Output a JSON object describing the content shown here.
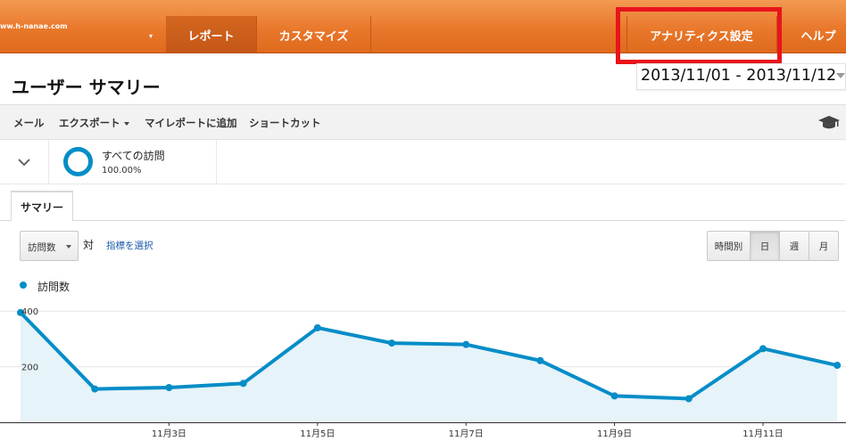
{
  "header": {
    "site": "ww.h-nanae.com",
    "nav": {
      "report": "レポート",
      "customize": "カスタマイズ",
      "analytics_settings": "アナリティクス設定",
      "help": "ヘルプ"
    }
  },
  "page": {
    "title": "ユーザー サマリー",
    "date_range": "2013/11/01 - 2013/11/12"
  },
  "toolbar": {
    "mail": "メール",
    "export": "エクスポート",
    "add_to_my_report": "マイレポートに追加",
    "shortcut": "ショートカット",
    "icon": "graduation-cap-icon"
  },
  "segment": {
    "name": "すべての訪問",
    "percent": "100.00%"
  },
  "tabs": {
    "summary": "サマリー"
  },
  "controls": {
    "metric": "訪問数",
    "versus": "対",
    "select_metric": "指標を選択",
    "granularity": {
      "hourly": "時間別",
      "day": "日",
      "week": "週",
      "month": "月",
      "selected": "日"
    }
  },
  "colors": {
    "nav_orange": "#e9782b",
    "series": "#058dc7",
    "highlight": "#e8141b"
  },
  "chart_data": {
    "type": "area",
    "series": [
      {
        "name": "訪問数",
        "x": [
          "11月1日",
          "11月2日",
          "11月3日",
          "11月4日",
          "11月5日",
          "11月6日",
          "11月7日",
          "11月8日",
          "11月9日",
          "11月10日",
          "11月11日",
          "11月12日"
        ],
        "values": [
          395,
          120,
          125,
          140,
          340,
          285,
          280,
          222,
          95,
          85,
          265,
          205
        ]
      }
    ],
    "y_ticks": [
      "400",
      "200"
    ],
    "x_tick_labels": [
      "11月3日",
      "11月5日",
      "11月7日",
      "11月9日",
      "11月11日"
    ],
    "ylim": [
      0,
      420
    ],
    "grid": true
  }
}
